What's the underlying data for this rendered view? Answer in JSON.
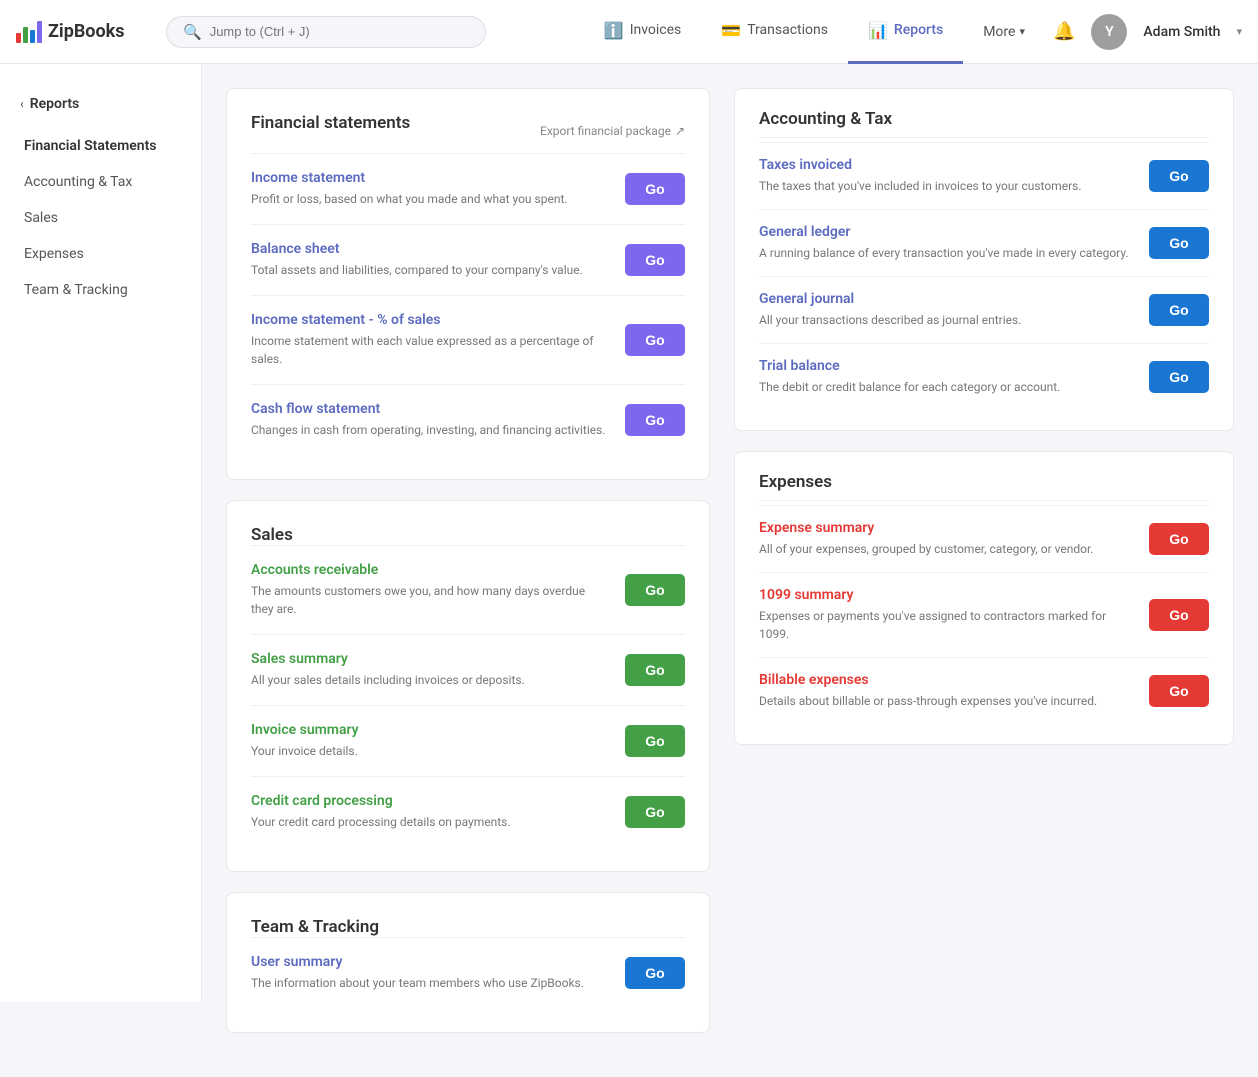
{
  "app": {
    "name": "ZipBooks"
  },
  "topnav": {
    "search_placeholder": "Jump to (Ctrl + J)",
    "links": [
      {
        "id": "invoices",
        "label": "Invoices",
        "icon": "ℹ",
        "active": false
      },
      {
        "id": "transactions",
        "label": "Transactions",
        "icon": "💳",
        "active": false
      },
      {
        "id": "reports",
        "label": "Reports",
        "icon": "📊",
        "active": true
      },
      {
        "id": "more",
        "label": "More",
        "active": false
      }
    ],
    "user": {
      "name": "Adam Smith",
      "avatar_initial": "Y"
    }
  },
  "sidebar": {
    "back_label": "Reports",
    "items": [
      {
        "id": "financial-statements",
        "label": "Financial Statements",
        "active": true
      },
      {
        "id": "accounting-tax",
        "label": "Accounting & Tax",
        "active": false
      },
      {
        "id": "sales",
        "label": "Sales",
        "active": false
      },
      {
        "id": "expenses",
        "label": "Expenses",
        "active": false
      },
      {
        "id": "team-tracking",
        "label": "Team & Tracking",
        "active": false
      }
    ]
  },
  "main": {
    "financial_statements": {
      "title": "Financial statements",
      "export_label": "Export financial package",
      "items": [
        {
          "id": "income-statement",
          "title": "Income statement",
          "desc": "Profit or loss, based on what you made and what you spent.",
          "color": "blue",
          "btn_color": "purple",
          "btn_label": "Go"
        },
        {
          "id": "balance-sheet",
          "title": "Balance sheet",
          "desc": "Total assets and liabilities, compared to your company's value.",
          "color": "blue",
          "btn_color": "purple",
          "btn_label": "Go"
        },
        {
          "id": "income-statement-pct",
          "title": "Income statement - % of sales",
          "desc": "Income statement with each value expressed as a percentage of sales.",
          "color": "blue",
          "btn_color": "purple",
          "btn_label": "Go"
        },
        {
          "id": "cash-flow",
          "title": "Cash flow statement",
          "desc": "Changes in cash from operating, investing, and financing activities.",
          "color": "blue",
          "btn_color": "purple",
          "btn_label": "Go"
        }
      ]
    },
    "sales": {
      "title": "Sales",
      "items": [
        {
          "id": "accounts-receivable",
          "title": "Accounts receivable",
          "desc": "The amounts customers owe you, and how many days overdue they are.",
          "color": "green",
          "btn_color": "green",
          "btn_label": "Go"
        },
        {
          "id": "sales-summary",
          "title": "Sales summary",
          "desc": "All your sales details including invoices or deposits.",
          "color": "green",
          "btn_color": "green",
          "btn_label": "Go"
        },
        {
          "id": "invoice-summary",
          "title": "Invoice summary",
          "desc": "Your invoice details.",
          "color": "green",
          "btn_color": "green",
          "btn_label": "Go"
        },
        {
          "id": "credit-card-processing",
          "title": "Credit card processing",
          "desc": "Your credit card processing details on payments.",
          "color": "green",
          "btn_color": "green",
          "btn_label": "Go"
        }
      ]
    },
    "team_tracking": {
      "title": "Team & Tracking",
      "items": [
        {
          "id": "user-summary",
          "title": "User summary",
          "desc": "The information about your team members who use ZipBooks.",
          "color": "blue",
          "btn_color": "blue",
          "btn_label": "Go"
        }
      ]
    }
  },
  "right": {
    "accounting_tax": {
      "title": "Accounting & Tax",
      "items": [
        {
          "id": "taxes-invoiced",
          "title": "Taxes invoiced",
          "desc": "The taxes that you've included in invoices to your customers.",
          "color": "blue",
          "btn_color": "blue",
          "btn_label": "Go"
        },
        {
          "id": "general-ledger",
          "title": "General ledger",
          "desc": "A running balance of every transaction you've made in every category.",
          "color": "blue",
          "btn_color": "blue",
          "btn_label": "Go"
        },
        {
          "id": "general-journal",
          "title": "General journal",
          "desc": "All your transactions described as journal entries.",
          "color": "blue",
          "btn_color": "blue",
          "btn_label": "Go"
        },
        {
          "id": "trial-balance",
          "title": "Trial balance",
          "desc": "The debit or credit balance for each category or account.",
          "color": "blue",
          "btn_color": "blue",
          "btn_label": "Go"
        }
      ]
    },
    "expenses": {
      "title": "Expenses",
      "items": [
        {
          "id": "expense-summary",
          "title": "Expense summary",
          "desc": "All of your expenses, grouped by customer, category, or vendor.",
          "color": "red",
          "btn_color": "red",
          "btn_label": "Go"
        },
        {
          "id": "1099-summary",
          "title": "1099 summary",
          "desc": "Expenses or payments you've assigned to contractors marked for 1099.",
          "color": "red",
          "btn_color": "red",
          "btn_label": "Go"
        },
        {
          "id": "billable-expenses",
          "title": "Billable expenses",
          "desc": "Details about billable or pass-through expenses you've incurred.",
          "color": "red",
          "btn_color": "red",
          "btn_label": "Go"
        }
      ]
    }
  },
  "colors": {
    "purple": "#7b68ee",
    "blue": "#1976d2",
    "green": "#43a047",
    "red": "#e53935",
    "link_blue": "#5c6bc0",
    "link_green": "#43a047",
    "link_red": "#e53935"
  }
}
